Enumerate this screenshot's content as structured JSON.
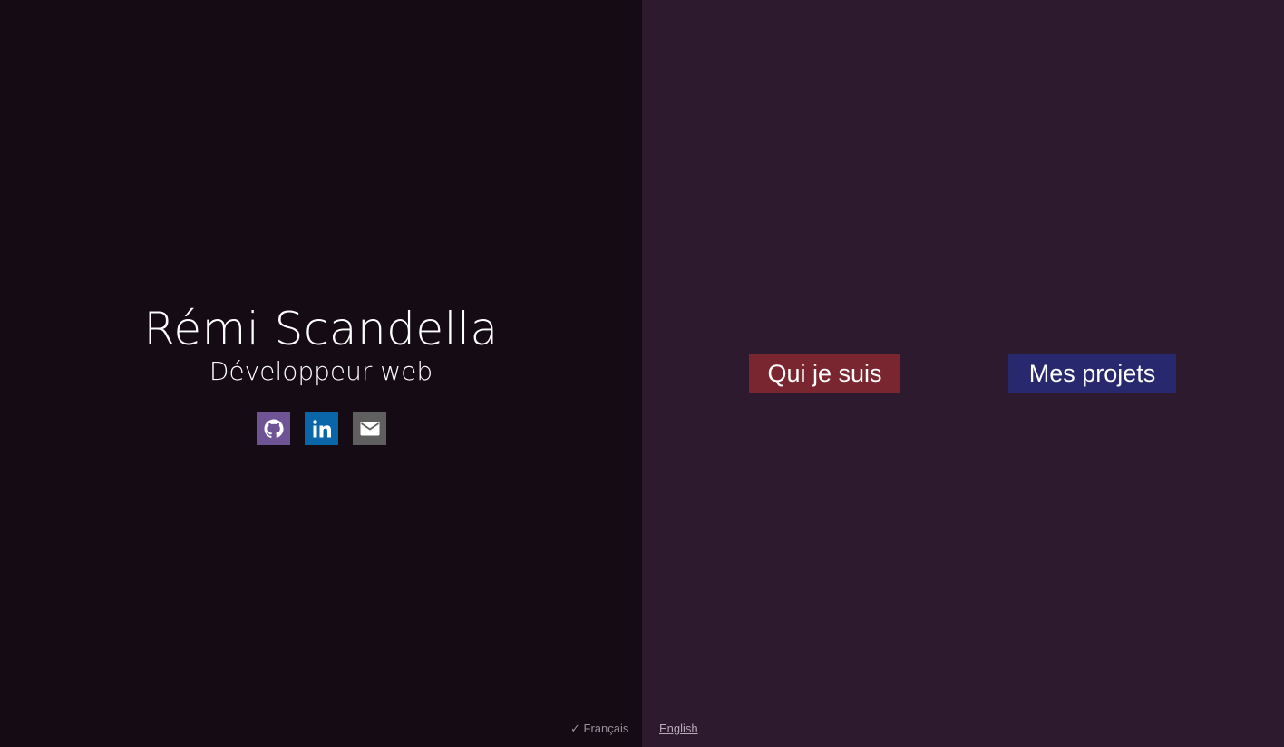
{
  "profile": {
    "name": "Rémi Scandella",
    "role": "Développeur web"
  },
  "socials": [
    {
      "icon": "github-icon",
      "color": "#6e5494"
    },
    {
      "icon": "linkedin-icon",
      "color": "#0a66a8"
    },
    {
      "icon": "mail-icon",
      "color": "#5f5f5f"
    }
  ],
  "nav": {
    "about_label": "Qui je suis",
    "about_color": "#7a2630",
    "projects_label": "Mes projets",
    "projects_color": "#28286e"
  },
  "language": {
    "current": "✓ Français",
    "other": "English"
  },
  "colors": {
    "left_bg": "#140b14",
    "right_bg": "#2d1a2e"
  }
}
